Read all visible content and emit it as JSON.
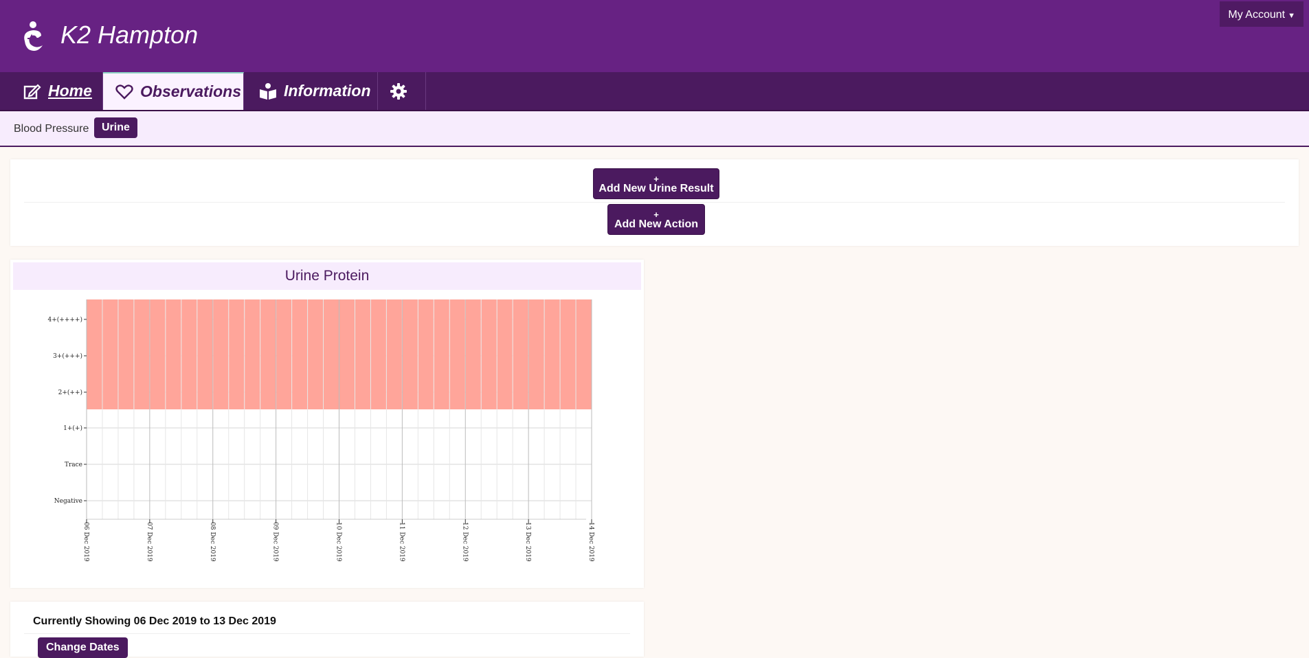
{
  "header": {
    "brand": "K2 Hampton",
    "account_menu": "My Account"
  },
  "nav": {
    "tabs": [
      {
        "label": "Home",
        "icon": "edit-icon"
      },
      {
        "label": "Observations",
        "icon": "heart-icon",
        "active": true
      },
      {
        "label": "Information",
        "icon": "reader-icon"
      },
      {
        "label": "",
        "icon": "gear-icon"
      }
    ]
  },
  "subnav": {
    "items": [
      {
        "label": "Blood Pressure"
      },
      {
        "label": "Urine",
        "active": true
      }
    ]
  },
  "actions": {
    "add_urine": {
      "plus": "+",
      "label": "Add New Urine Result"
    },
    "add_action": {
      "plus": "+",
      "label": "Add New Action"
    }
  },
  "colors": {
    "brand_purple": "#672283",
    "nav_purple": "#4b1a5f",
    "subnav_bg": "#f7ecfd",
    "alert_band": "#ffa59a"
  },
  "chart_data": {
    "type": "heatmap",
    "title": "Urine Protein",
    "y_categories": [
      "Negative",
      "Trace",
      "1+(+)",
      "2+(++)",
      "3+(+++)",
      "4+(++++)"
    ],
    "x_tick_labels": [
      "06 Dec 2019",
      "07 Dec 2019",
      "08 Dec 2019",
      "09 Dec 2019",
      "10 Dec 2019",
      "11 Dec 2019",
      "12 Dec 2019",
      "13 Dec 2019",
      "14 Dec 2019"
    ],
    "xlim": [
      "06 Dec 2019",
      "14 Dec 2019"
    ],
    "alert_band": {
      "from_category": "2+(++)",
      "to_category": "above 4+(++++)"
    },
    "columns_per_day": 4,
    "grid": true,
    "data_points": []
  },
  "date_range": {
    "text": "Currently Showing 06 Dec 2019 to 13 Dec 2019",
    "button": "Change Dates"
  }
}
